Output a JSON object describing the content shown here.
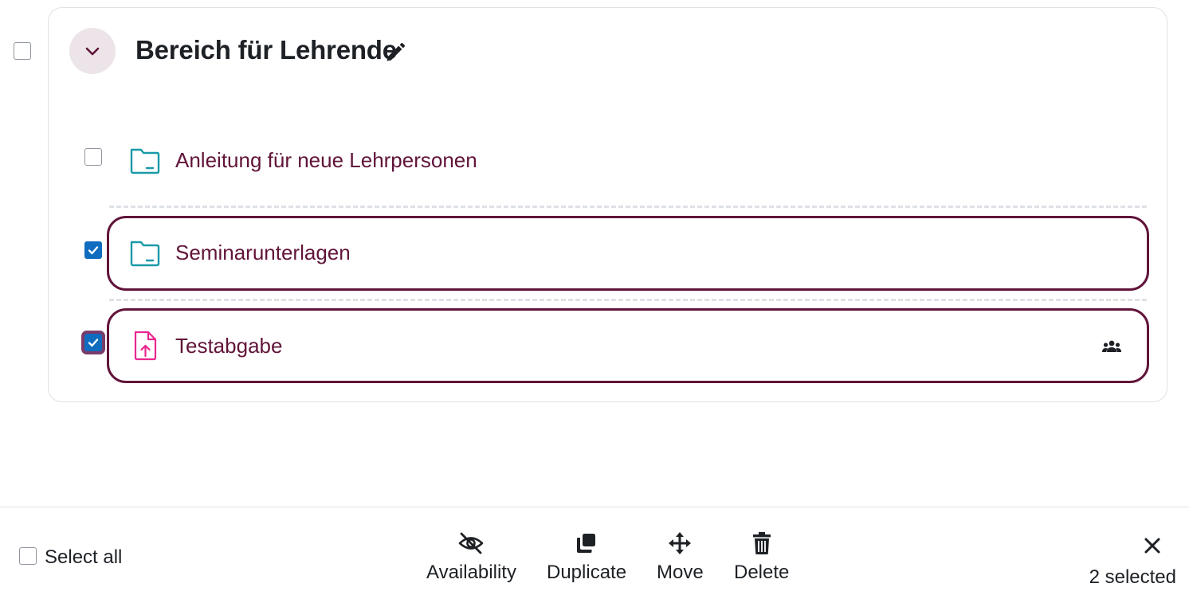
{
  "section": {
    "title": "Bereich für Lehrende"
  },
  "activities": [
    {
      "name": "Anleitung für neue Lehrpersonen",
      "type": "folder",
      "checked": false
    },
    {
      "name": "Seminarunterlagen",
      "type": "folder",
      "checked": true
    },
    {
      "name": "Testabgabe",
      "type": "assignment",
      "checked": true,
      "group_mode": true
    }
  ],
  "bulk_bar": {
    "select_all_label": "Select all",
    "actions": {
      "availability": "Availability",
      "duplicate": "Duplicate",
      "move": "Move",
      "delete": "Delete"
    },
    "selected_count": "2 selected"
  },
  "colors": {
    "brand": "#611439",
    "folder_icon": "#1a9aa8",
    "assignment_icon": "#e8268f",
    "checkbox_checked": "#0f6cbf",
    "collapse_bg": "#ece4e9"
  }
}
